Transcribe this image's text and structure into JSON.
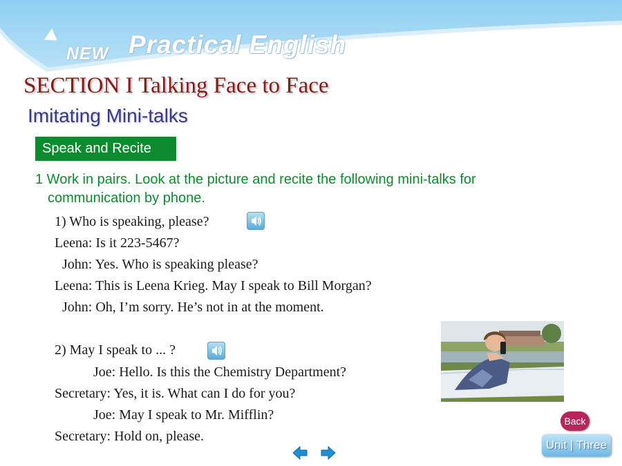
{
  "brand": {
    "new": "NEW",
    "name": "Practical English"
  },
  "section_title": "SECTION I  Talking Face to Face",
  "subtitle": "Imitating Mini-talks",
  "tag": "Speak and Recite",
  "instruction": {
    "line1": "1 Work in pairs. Look at the picture and recite the following mini-talks for",
    "line2": "communication by phone."
  },
  "talk1": {
    "heading": "1) Who is speaking, please?",
    "lines": [
      "Leena: Is it 223-5467?",
      "John: Yes. Who is speaking please?",
      "Leena: This is Leena Krieg. May I speak to Bill Morgan?",
      "John: Oh, I’m sorry. He’s not in at the moment."
    ]
  },
  "talk2": {
    "heading": "2) May I speak to ... ?",
    "lines": [
      "Joe: Hello. Is this the Chemistry Department?",
      "Secretary: Yes, it is. What can I do for you?",
      "Joe: May I speak to Mr. Mifflin?",
      "Secretary: Hold on, please."
    ]
  },
  "buttons": {
    "back": "Back",
    "unit": "Unit | Three"
  },
  "icons": {
    "audio": "speaker-icon",
    "prev": "arrow-left-icon",
    "next": "arrow-right-icon"
  },
  "colors": {
    "section": "#8b1a1a",
    "subtitle": "#3a3a8c",
    "green": "#0b8a2e",
    "back": "#b8245c",
    "sky": "#a8d6f2"
  }
}
